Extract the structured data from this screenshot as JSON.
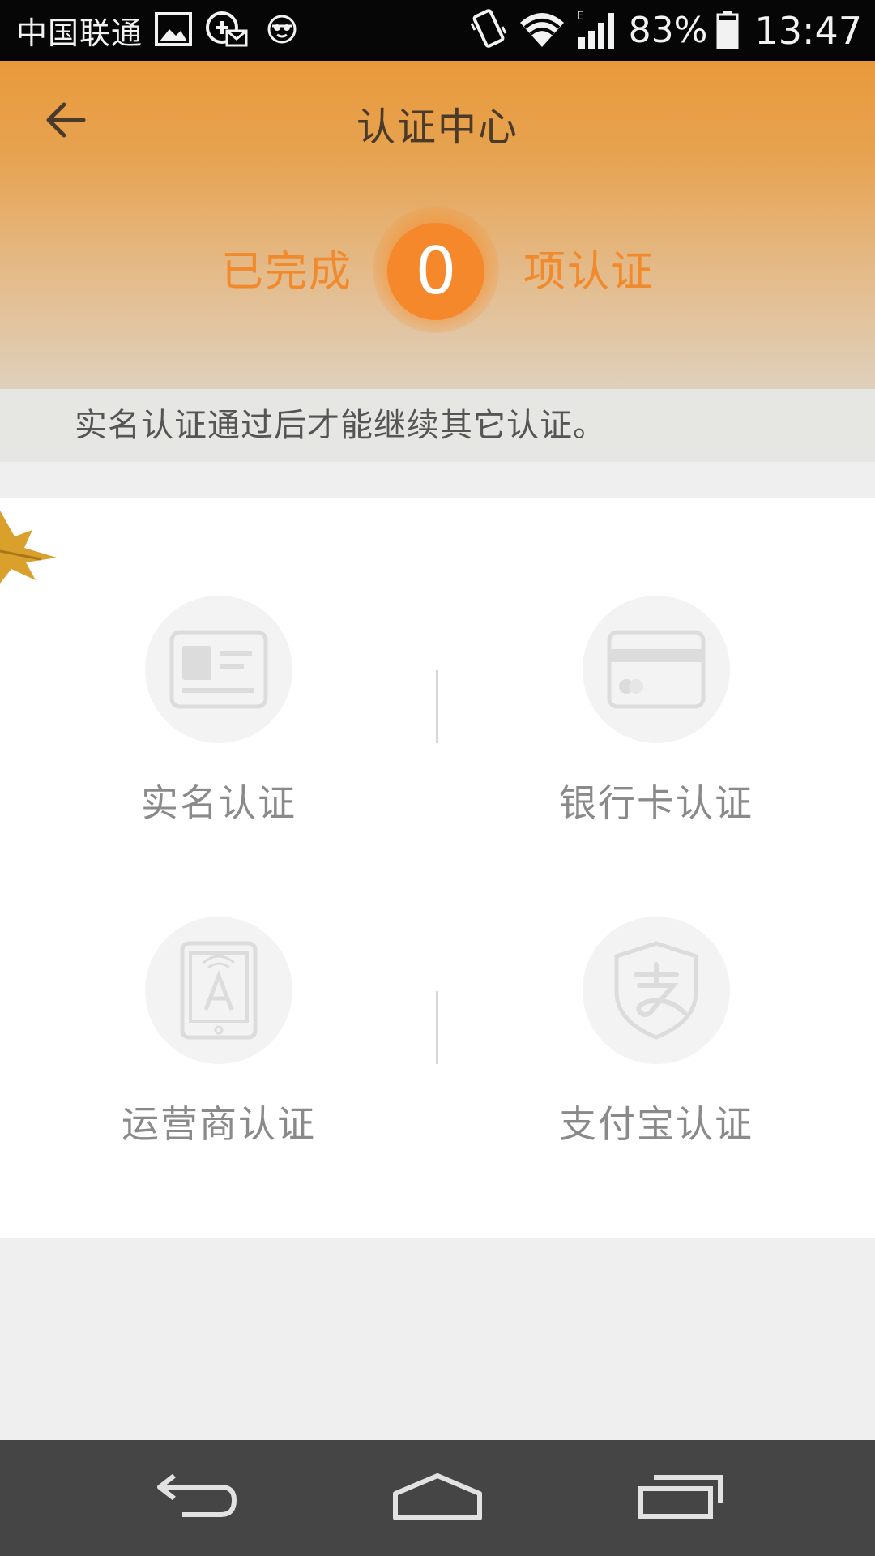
{
  "status_bar": {
    "carrier": "中国联通",
    "battery_percent": "83%",
    "time": "13:47",
    "icons": [
      "gallery-icon",
      "mail-icon",
      "face-icon",
      "vibrate-icon",
      "wifi-icon",
      "signal-icon",
      "battery-icon"
    ]
  },
  "header": {
    "title": "认证中心",
    "back_icon": "arrow-left-icon",
    "progress_prefix": "已完成",
    "completed_count": "0",
    "progress_suffix": "项认证"
  },
  "notice": "实名认证通过后才能继续其它认证。",
  "verifications": [
    {
      "label": "实名认证",
      "icon": "id-card-icon"
    },
    {
      "label": "银行卡认证",
      "icon": "bank-card-icon"
    },
    {
      "label": "运营商认证",
      "icon": "carrier-phone-icon"
    },
    {
      "label": "支付宝认证",
      "icon": "alipay-shield-icon"
    }
  ],
  "nav_bar": {
    "icons": [
      "back-icon",
      "home-icon",
      "recents-icon"
    ]
  },
  "colors": {
    "accent": "#f5882a",
    "header_top": "#e89a3a",
    "label_gray": "#8a8a8a"
  }
}
